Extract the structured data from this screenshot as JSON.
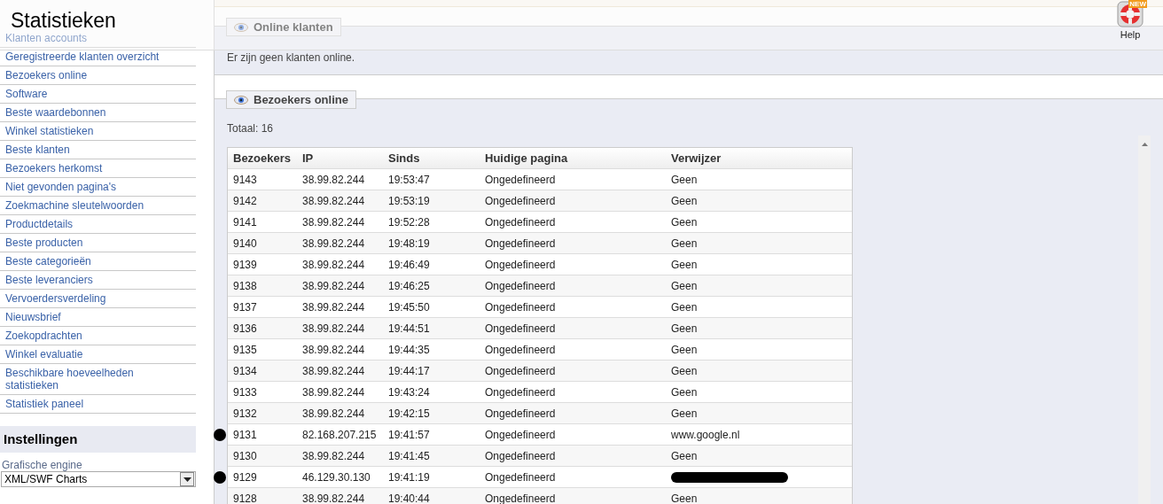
{
  "header": {
    "title": "Statistieken",
    "help": {
      "label": "Help",
      "badge": "NEW"
    }
  },
  "sidebar": {
    "items": [
      {
        "label": "Klanten accounts",
        "covered": false
      },
      {
        "label": "Geregistreerde klanten overzicht",
        "covered": false
      },
      {
        "label": "Bezoekers online",
        "covered": false
      },
      {
        "label": "Software",
        "covered": false
      },
      {
        "label": "Beste waardebonnen",
        "covered": false
      },
      {
        "label": "Winkel statistieken",
        "covered": false
      },
      {
        "label": "Beste klanten",
        "covered": false
      },
      {
        "label": "Bezoekers herkomst",
        "covered": false
      },
      {
        "label": "Niet gevonden pagina's",
        "covered": false
      },
      {
        "label": "Zoekmachine sleutelwoorden",
        "covered": false
      },
      {
        "label": "Productdetails",
        "covered": false
      },
      {
        "label": "Beste producten",
        "covered": false
      },
      {
        "label": "Beste categorieën",
        "covered": false
      },
      {
        "label": "Beste leveranciers",
        "covered": false
      },
      {
        "label": "Vervoerdersverdeling",
        "covered": false
      },
      {
        "label": "Nieuwsbrief",
        "covered": false
      },
      {
        "label": "Zoekopdrachten",
        "covered": false
      },
      {
        "label": "Winkel evaluatie",
        "covered": false
      },
      {
        "label": "Beschikbare hoeveelheden statistieken",
        "covered": false
      },
      {
        "label": "Statistiek paneel",
        "covered": false
      }
    ],
    "settings": {
      "title": "Instellingen",
      "field_label": "Grafische engine",
      "value": "XML/SWF Charts"
    }
  },
  "online_customers": {
    "title": "Online klanten",
    "message": "Er zijn geen klanten online."
  },
  "online_visitors": {
    "title": "Bezoekers online",
    "total": "Totaal: 16",
    "columns": [
      "Bezoekers",
      "IP",
      "Sinds",
      "Huidige pagina",
      "Verwijzer"
    ],
    "rows": [
      {
        "cells": [
          "9143",
          "38.99.82.244",
          "19:53:47",
          "Ongedefineerd",
          "Geen"
        ],
        "marked": false,
        "redacted": false
      },
      {
        "cells": [
          "9142",
          "38.99.82.244",
          "19:53:19",
          "Ongedefineerd",
          "Geen"
        ],
        "marked": false,
        "redacted": false
      },
      {
        "cells": [
          "9141",
          "38.99.82.244",
          "19:52:28",
          "Ongedefineerd",
          "Geen"
        ],
        "marked": false,
        "redacted": false
      },
      {
        "cells": [
          "9140",
          "38.99.82.244",
          "19:48:19",
          "Ongedefineerd",
          "Geen"
        ],
        "marked": false,
        "redacted": false
      },
      {
        "cells": [
          "9139",
          "38.99.82.244",
          "19:46:49",
          "Ongedefineerd",
          "Geen"
        ],
        "marked": false,
        "redacted": false
      },
      {
        "cells": [
          "9138",
          "38.99.82.244",
          "19:46:25",
          "Ongedefineerd",
          "Geen"
        ],
        "marked": false,
        "redacted": false
      },
      {
        "cells": [
          "9137",
          "38.99.82.244",
          "19:45:50",
          "Ongedefineerd",
          "Geen"
        ],
        "marked": false,
        "redacted": false
      },
      {
        "cells": [
          "9136",
          "38.99.82.244",
          "19:44:51",
          "Ongedefineerd",
          "Geen"
        ],
        "marked": false,
        "redacted": false
      },
      {
        "cells": [
          "9135",
          "38.99.82.244",
          "19:44:35",
          "Ongedefineerd",
          "Geen"
        ],
        "marked": false,
        "redacted": false
      },
      {
        "cells": [
          "9134",
          "38.99.82.244",
          "19:44:17",
          "Ongedefineerd",
          "Geen"
        ],
        "marked": false,
        "redacted": false
      },
      {
        "cells": [
          "9133",
          "38.99.82.244",
          "19:43:24",
          "Ongedefineerd",
          "Geen"
        ],
        "marked": false,
        "redacted": false
      },
      {
        "cells": [
          "9132",
          "38.99.82.244",
          "19:42:15",
          "Ongedefineerd",
          "Geen"
        ],
        "marked": false,
        "redacted": false
      },
      {
        "cells": [
          "9131",
          "82.168.207.215",
          "19:41:57",
          "Ongedefineerd",
          "www.google.nl"
        ],
        "marked": true,
        "redacted": false
      },
      {
        "cells": [
          "9130",
          "38.99.82.244",
          "19:41:45",
          "Ongedefineerd",
          "Geen"
        ],
        "marked": false,
        "redacted": false
      },
      {
        "cells": [
          "9129",
          "46.129.30.130",
          "19:41:19",
          "Ongedefineerd"
        ],
        "marked": true,
        "redacted": true
      },
      {
        "cells": [
          "9128",
          "38.99.82.244",
          "19:40:44",
          "Ongedefineerd",
          "Geen"
        ],
        "marked": false,
        "redacted": false
      }
    ]
  }
}
